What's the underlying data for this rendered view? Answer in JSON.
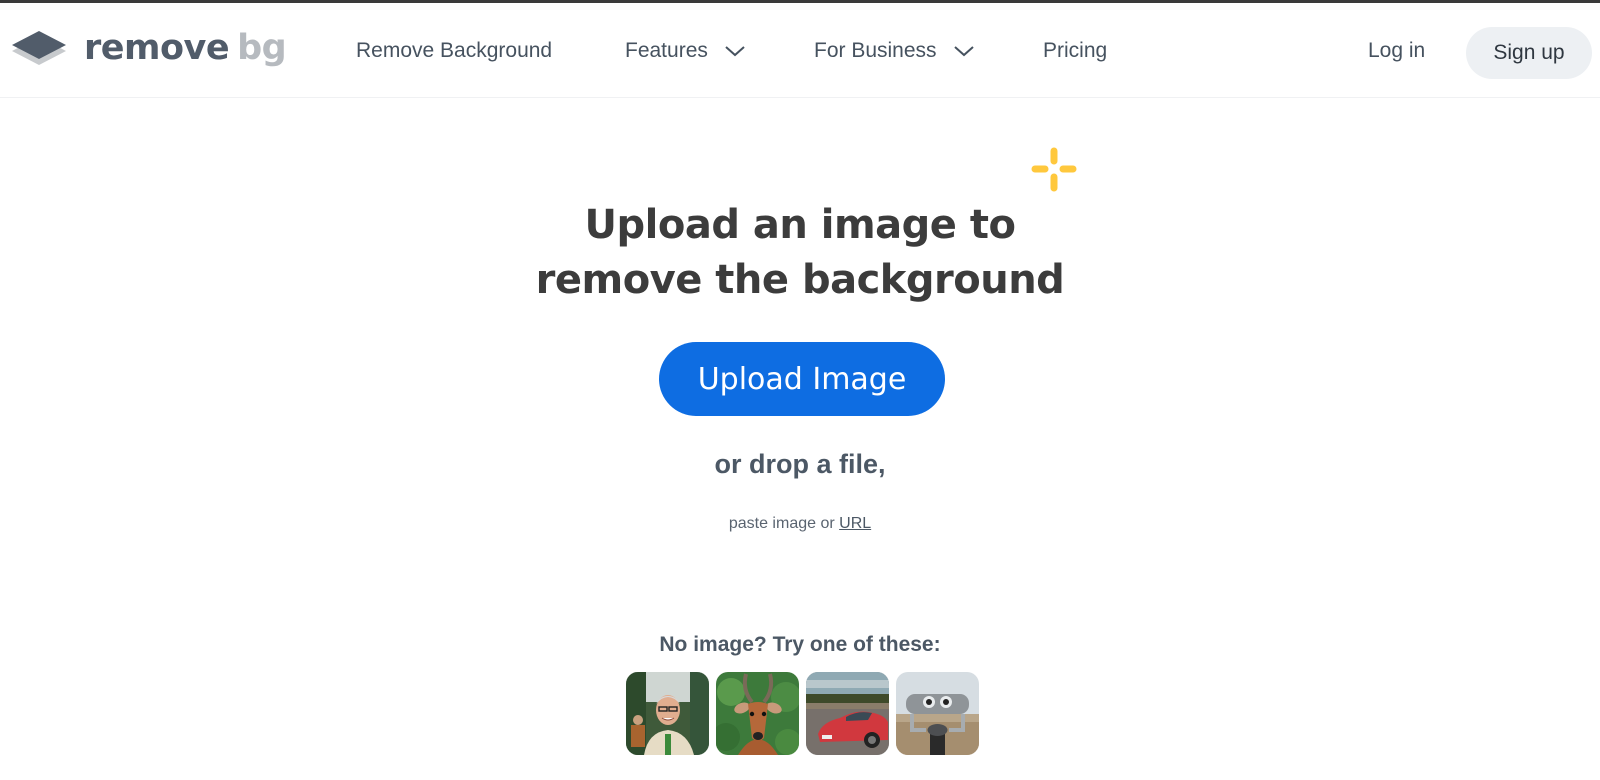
{
  "header": {
    "logo": {
      "word1": "remove",
      "word2": "bg"
    },
    "nav": [
      {
        "label": "Remove Background",
        "has_dropdown": false
      },
      {
        "label": "Features",
        "has_dropdown": true
      },
      {
        "label": "For Business",
        "has_dropdown": true
      },
      {
        "label": "Pricing",
        "has_dropdown": false
      }
    ],
    "login_label": "Log in",
    "signup_label": "Sign up"
  },
  "hero": {
    "headline_line1": "Upload an image to",
    "headline_line2": "remove the background",
    "upload_button": "Upload Image",
    "drop_text": "or drop a file,",
    "paste_text": "paste image or",
    "url_link": "URL"
  },
  "samples": {
    "label": "No image? Try one of these:",
    "items": [
      {
        "name": "person",
        "description": "Smiling man with glasses"
      },
      {
        "name": "animal",
        "description": "Impala antelope"
      },
      {
        "name": "car",
        "description": "Red sports car"
      },
      {
        "name": "object",
        "description": "Coin-operated binoculars"
      }
    ]
  },
  "colors": {
    "primary": "#0e6de2",
    "accent": "#ffc83d",
    "text": "#454f5b",
    "headline": "#3c3c3c"
  }
}
